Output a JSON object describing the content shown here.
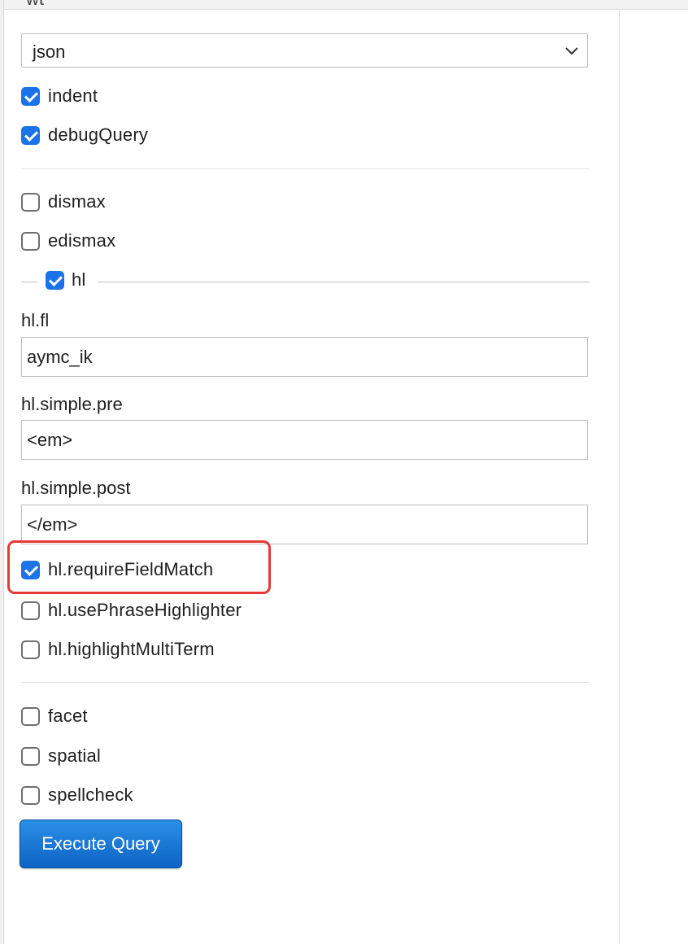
{
  "header": {
    "cut_label": "wt"
  },
  "wt_select": {
    "value": "json"
  },
  "options": {
    "indent": {
      "label": "indent",
      "checked": true
    },
    "debugQuery": {
      "label": "debugQuery",
      "checked": true
    }
  },
  "parsers": {
    "dismax": {
      "label": "dismax",
      "checked": false
    },
    "edismax": {
      "label": "edismax",
      "checked": false
    }
  },
  "hl": {
    "legend": {
      "label": "hl",
      "checked": true
    },
    "fl": {
      "label": "hl.fl",
      "value": "aymc_ik"
    },
    "simple_pre": {
      "label": "hl.simple.pre",
      "value": "<em>"
    },
    "simple_post": {
      "label": "hl.simple.post",
      "value": "</em>"
    },
    "requireFieldMatch": {
      "label": "hl.requireFieldMatch",
      "checked": true
    },
    "usePhraseHighlighter": {
      "label": "hl.usePhraseHighlighter",
      "checked": false
    },
    "highlightMultiTerm": {
      "label": "hl.highlightMultiTerm",
      "checked": false
    }
  },
  "extras": {
    "facet": {
      "label": "facet",
      "checked": false
    },
    "spatial": {
      "label": "spatial",
      "checked": false
    },
    "spellcheck": {
      "label": "spellcheck",
      "checked": false
    }
  },
  "actions": {
    "execute_label": "Execute Query"
  },
  "colors": {
    "accent": "#1a73e8",
    "highlight_border": "#e53935",
    "button": "#1572d3"
  }
}
